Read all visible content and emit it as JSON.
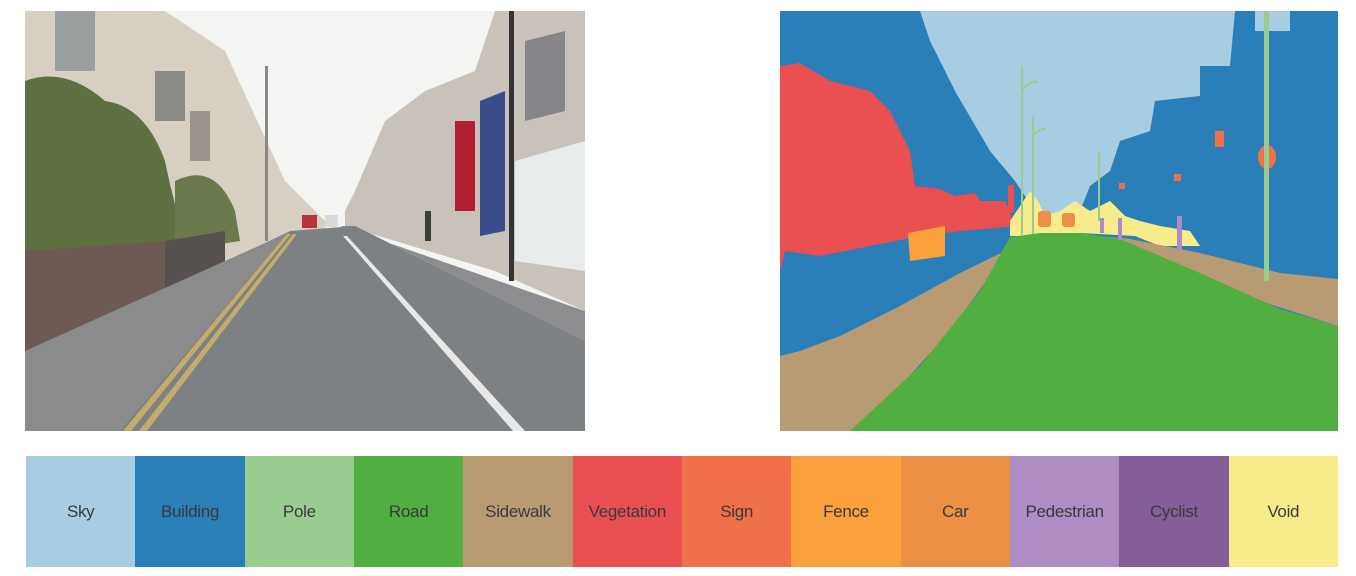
{
  "figure": {
    "left_panel": {
      "kind": "photo",
      "subject": "street-scene"
    },
    "right_panel": {
      "kind": "segmentation-map",
      "subject": "street-scene-labels"
    }
  },
  "legend": [
    {
      "label": "Sky",
      "color": "#a6cde2"
    },
    {
      "label": "Building",
      "color": "#2b7fb8"
    },
    {
      "label": "Pole",
      "color": "#98cd8f"
    },
    {
      "label": "Road",
      "color": "#51ae41"
    },
    {
      "label": "Sidewalk",
      "color": "#b89b72"
    },
    {
      "label": "Vegetation",
      "color": "#ea5052"
    },
    {
      "label": "Sign",
      "color": "#f07049"
    },
    {
      "label": "Fence",
      "color": "#fca03d"
    },
    {
      "label": "Car",
      "color": "#ec9045"
    },
    {
      "label": "Pedestrian",
      "color": "#ad8dc3"
    },
    {
      "label": "Cyclist",
      "color": "#835e98"
    },
    {
      "label": "Void",
      "color": "#f6ec8c"
    }
  ]
}
